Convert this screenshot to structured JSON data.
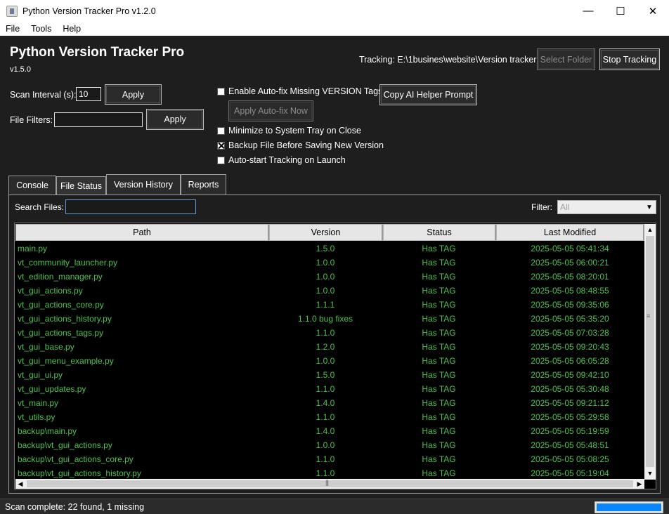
{
  "window": {
    "title": "Python Version Tracker Pro v1.2.0",
    "controls": {
      "minimize": "—",
      "maximize": "☐",
      "close": "✕"
    }
  },
  "menu": [
    "File",
    "Tools",
    "Help"
  ],
  "header": {
    "title": "Python Version Tracker Pro",
    "version": "v1.5.0",
    "tracking": "Tracking: E:\\1busines\\website\\Version tracker"
  },
  "buttons": {
    "select_folder": "Select Folder",
    "stop_tracking": "Stop Tracking",
    "apply_interval": "Apply",
    "apply_filters": "Apply",
    "copy_prompt": "Copy AI Helper Prompt",
    "apply_autofix": "Apply Auto-fix Now"
  },
  "settings": {
    "scan_interval_label": "Scan Interval (s):",
    "scan_interval_value": "10",
    "file_filters_label": "File Filters:",
    "file_filters_value": ""
  },
  "options": [
    {
      "label": "Enable Auto-fix Missing VERSION Tags",
      "checked": false
    },
    {
      "label": "Minimize to System Tray on Close",
      "checked": false
    },
    {
      "label": "Backup File Before Saving New Version",
      "checked": true
    },
    {
      "label": "Auto-start Tracking on Launch",
      "checked": false
    }
  ],
  "tabs": [
    "Console",
    "File Status",
    "Version History",
    "Reports"
  ],
  "active_tab": "File Status",
  "file_status": {
    "search_label": "Search Files:",
    "search_value": "",
    "filter_label": "Filter:",
    "filter_value": "All",
    "columns": [
      "Path",
      "Version",
      "Status",
      "Last Modified"
    ],
    "rows": [
      [
        "main.py",
        "1.5.0",
        "Has TAG",
        "2025-05-05 05:41:34"
      ],
      [
        "vt_community_launcher.py",
        "1.0.0",
        "Has TAG",
        "2025-05-05 06:00:21"
      ],
      [
        "vt_edition_manager.py",
        "1.0.0",
        "Has TAG",
        "2025-05-05 08:20:01"
      ],
      [
        "vt_gui_actions.py",
        "1.0.0",
        "Has TAG",
        "2025-05-05 08:48:55"
      ],
      [
        "vt_gui_actions_core.py",
        "1.1.1",
        "Has TAG",
        "2025-05-05 09:35:06"
      ],
      [
        "vt_gui_actions_history.py",
        "1.1.0 bug fixes",
        "Has TAG",
        "2025-05-05 05:35:20"
      ],
      [
        "vt_gui_actions_tags.py",
        "1.1.0",
        "Has TAG",
        "2025-05-05 07:03:28"
      ],
      [
        "vt_gui_base.py",
        "1.2.0",
        "Has TAG",
        "2025-05-05 09:20:43"
      ],
      [
        "vt_gui_menu_example.py",
        "1.0.0",
        "Has TAG",
        "2025-05-05 06:05:28"
      ],
      [
        "vt_gui_ui.py",
        "1.5.0",
        "Has TAG",
        "2025-05-05 09:42:10"
      ],
      [
        "vt_gui_updates.py",
        "1.1.0",
        "Has TAG",
        "2025-05-05 05:30:48"
      ],
      [
        "vt_main.py",
        "1.4.0",
        "Has TAG",
        "2025-05-05 09:21:12"
      ],
      [
        "vt_utils.py",
        "1.1.0",
        "Has TAG",
        "2025-05-05 05:29:58"
      ],
      [
        "backup\\main.py",
        "1.4.0",
        "Has TAG",
        "2025-05-05 05:19:59"
      ],
      [
        "backup\\vt_gui_actions.py",
        "1.0.0",
        "Has TAG",
        "2025-05-05 05:48:51"
      ],
      [
        "backup\\vt_gui_actions_core.py",
        "1.1.0",
        "Has TAG",
        "2025-05-05 05:08:25"
      ],
      [
        "backup\\vt_gui_actions_history.py",
        "1.1.0",
        "Has TAG",
        "2025-05-05 05:19:04"
      ]
    ]
  },
  "status_bar": {
    "text": "Scan complete: 22 found, 1 missing",
    "progress": 1.0
  },
  "colors": {
    "row_text": "#4ec24e",
    "accent": "#0a84ff",
    "background": "#1e1e1e"
  }
}
